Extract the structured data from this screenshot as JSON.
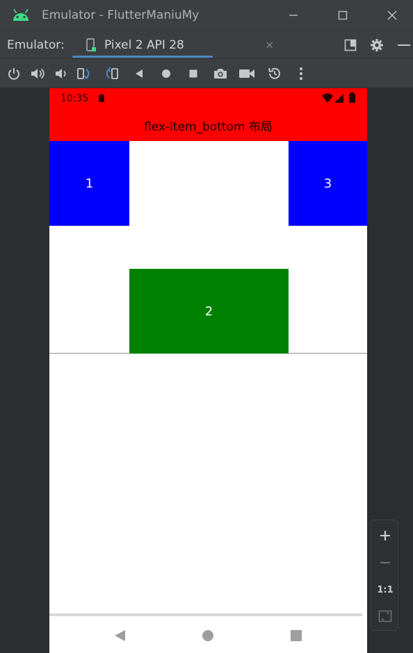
{
  "window": {
    "title": "Emulator - FlutterManiuMy"
  },
  "tabbar": {
    "label": "Emulator:",
    "device_tab": "Pixel 2 API 28"
  },
  "device": {
    "status_time": "10:35",
    "app_title": "flex-item_bottom 布局",
    "items": [
      {
        "label": "1",
        "color": "#0000ff"
      },
      {
        "label": "2",
        "color": "#008000"
      },
      {
        "label": "3",
        "color": "#0000ff"
      }
    ],
    "appbar_color": "#ff0000"
  },
  "zoom": {
    "one_to_one": "1:1"
  },
  "colors": {
    "accent": "#4a88c7",
    "android_green": "#3ddc84"
  }
}
